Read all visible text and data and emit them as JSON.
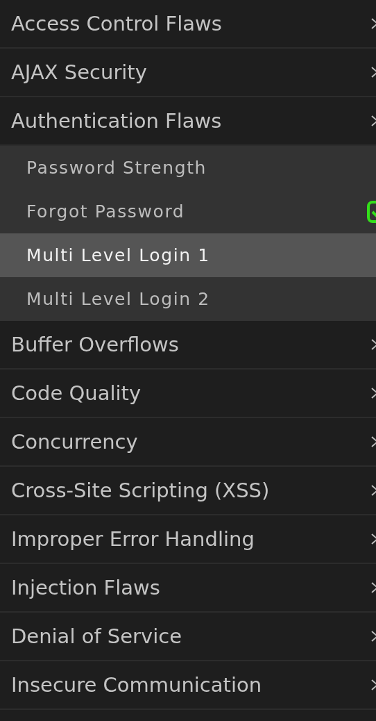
{
  "menu": [
    {
      "label": "Access Control Flaws"
    },
    {
      "label": "AJAX Security"
    },
    {
      "label": "Authentication Flaws",
      "children": [
        {
          "label": "Password Strength",
          "selected": false,
          "completed": false
        },
        {
          "label": "Forgot Password",
          "selected": false,
          "completed": true
        },
        {
          "label": "Multi Level Login 1",
          "selected": true,
          "completed": false
        },
        {
          "label": "Multi Level Login 2",
          "selected": false,
          "completed": false
        }
      ]
    },
    {
      "label": "Buffer Overflows"
    },
    {
      "label": "Code Quality"
    },
    {
      "label": "Concurrency"
    },
    {
      "label": "Cross-Site Scripting (XSS)"
    },
    {
      "label": "Improper Error Handling"
    },
    {
      "label": "Injection Flaws"
    },
    {
      "label": "Denial of Service"
    },
    {
      "label": "Insecure Communication"
    }
  ]
}
